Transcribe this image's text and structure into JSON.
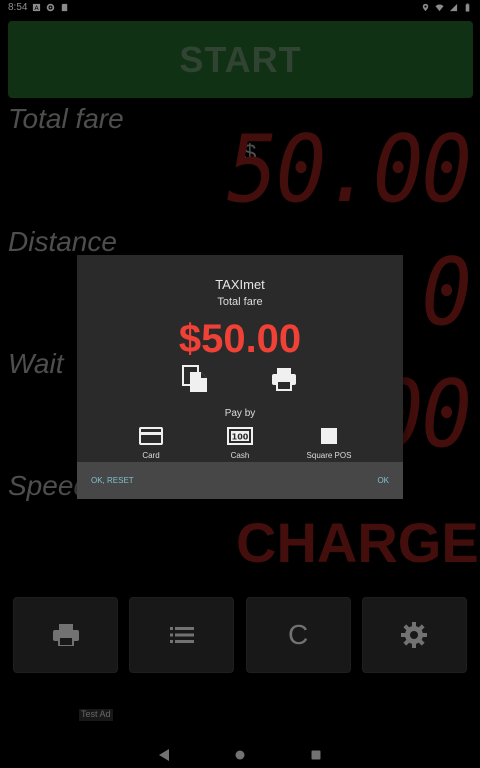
{
  "status_bar": {
    "time": "8:54"
  },
  "start_label": "START",
  "total_fare": {
    "label": "Total fare",
    "currency": "$",
    "value": "50.00"
  },
  "distance": {
    "label": "Distance",
    "value": "0.0"
  },
  "wait": {
    "label": "Wait",
    "value": "00"
  },
  "speed": {
    "label": "Speed"
  },
  "charge_label": "CHARGE",
  "toolbar": {
    "clear_label": "C"
  },
  "test_ad": "Test Ad",
  "dialog": {
    "title": "TAXImet",
    "subtitle": "Total fare",
    "amount": "$50.00",
    "pay_by": "Pay by",
    "options": [
      {
        "label": "Card",
        "icon": "card-icon"
      },
      {
        "label": "Cash",
        "icon": "cash-icon"
      },
      {
        "label": "Square POS",
        "icon": "square-icon"
      }
    ],
    "ok_reset": "OK, RESET",
    "ok": "OK"
  },
  "colors": {
    "accent_red": "#ef4136",
    "meter_red": "#7d1a16",
    "start_green": "#1e5a23",
    "link": "#7ec0d0"
  }
}
